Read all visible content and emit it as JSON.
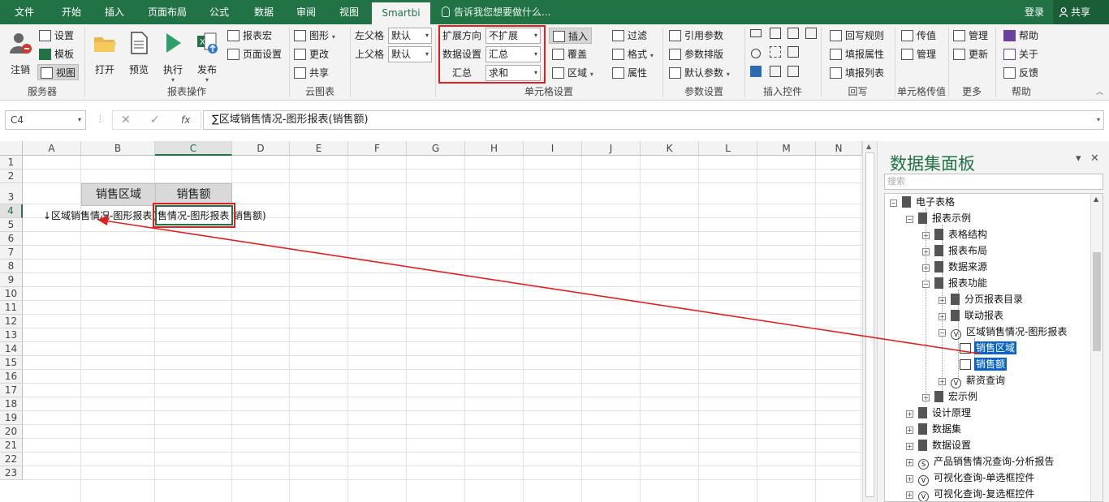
{
  "tabs": {
    "file": "文件",
    "home": "开始",
    "insert": "插入",
    "layout": "页面布局",
    "formula": "公式",
    "data": "数据",
    "review": "审阅",
    "view": "视图",
    "smartbi": "Smartbi"
  },
  "tell_me": "告诉我您想要做什么...",
  "login": "登录",
  "share": "共享",
  "ribbon": {
    "server": {
      "logout": "注销",
      "settings": "设置",
      "template": "模板",
      "view": "视图",
      "label": "服务器"
    },
    "report_ops": {
      "open": "打开",
      "preview": "预览",
      "execute": "执行",
      "publish": "发布",
      "macro": "报表宏",
      "page_setup": "页面设置",
      "label": "报表操作"
    },
    "cloud": {
      "chart": "图形",
      "change": "更改",
      "share": "共享",
      "label": "云图表"
    },
    "parent": {
      "left_label": "左父格",
      "left_value": "默认",
      "top_label": "上父格",
      "top_value": "默认"
    },
    "cell_settings": {
      "expand_label": "扩展方向",
      "expand_value": "不扩展",
      "data_label": "数据设置",
      "data_value": "汇总",
      "sum_label": "汇总",
      "sum_value": "求和",
      "insert": "插入",
      "overlay": "覆盖",
      "area": "区域",
      "label": "单元格设置"
    },
    "fmt": {
      "filter": "过滤",
      "format": "格式",
      "attr": "属性"
    },
    "params": {
      "ref": "引用参数",
      "arrange": "参数排版",
      "default": "默认参数",
      "label": "参数设置"
    },
    "controls": {
      "label": "插入控件"
    },
    "writeback": {
      "rule": "回写规则",
      "fill_attr": "填报属性",
      "fill_list": "填报列表",
      "label": "回写"
    },
    "cell_pass": {
      "pass": "传值",
      "manage": "管理",
      "label": "单元格传值"
    },
    "more": {
      "manage": "管理",
      "update": "更新",
      "label": "更多"
    },
    "help": {
      "help": "帮助",
      "about": "关于",
      "feedback": "反馈",
      "label": "帮助"
    }
  },
  "formula_bar": {
    "cell_ref": "C4",
    "cancel": "✕",
    "confirm": "✓",
    "fx": "fx",
    "formula": "∑区域销售情况-图形报表(销售额)"
  },
  "grid": {
    "columns": [
      "A",
      "B",
      "C",
      "D",
      "E",
      "F",
      "G",
      "H",
      "I",
      "J",
      "K",
      "L",
      "M",
      "N"
    ],
    "rows": [
      "1",
      "2",
      "3",
      "4",
      "5",
      "6",
      "7",
      "8",
      "9",
      "10",
      "11",
      "12",
      "13",
      "14",
      "15",
      "16",
      "17",
      "18",
      "19",
      "20",
      "21",
      "22",
      "23"
    ],
    "b3": "销售区域",
    "c3": "销售额",
    "b4": "↓区域销售情况-图形报表(",
    "c4": "售情况-图形报表",
    "d4": "销售额)"
  },
  "panel": {
    "title": "数据集面板",
    "pin": "▾",
    "close": "✕",
    "search_placeholder": "搜索",
    "tree": [
      "电子表格",
      "报表示例",
      "表格结构",
      "报表布局",
      "数据来源",
      "报表功能",
      "分页报表目录",
      "联动报表",
      "区域销售情况-图形报表",
      "销售区域",
      "销售额",
      "薪资查询",
      "宏示例",
      "设计原理",
      "数据集",
      "数据设置",
      "产品销售情况查询-分析报告",
      "可视化查询-单选框控件",
      "可视化查询-复选框控件"
    ]
  },
  "colors": {
    "brand": "#217346",
    "highlight": "#0a63c9",
    "annotation": "#e02020"
  }
}
